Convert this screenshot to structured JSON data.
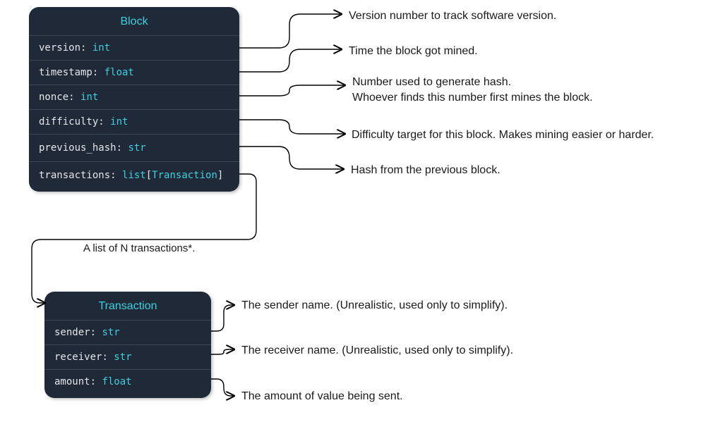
{
  "block": {
    "title": "Block",
    "fields": [
      {
        "name": "version",
        "type": "int"
      },
      {
        "name": "timestamp",
        "type": "float"
      },
      {
        "name": "nonce",
        "type": "int"
      },
      {
        "name": "difficulty",
        "type": "int"
      },
      {
        "name": "previous_hash",
        "type": "str"
      },
      {
        "name": "transactions",
        "type_prefix": "list",
        "type_inner": "Transaction"
      }
    ]
  },
  "transaction": {
    "title": "Transaction",
    "fields": [
      {
        "name": "sender",
        "type": "str"
      },
      {
        "name": "receiver",
        "type": "str"
      },
      {
        "name": "amount",
        "type": "float"
      }
    ]
  },
  "annotations": {
    "version": "Version number to track software version.",
    "timestamp": "Time the block got mined.",
    "nonce_line1": "Number used to generate hash.",
    "nonce_line2": "Whoever finds this number first mines the block.",
    "difficulty": "Difficulty target for this block. Makes mining easier or harder.",
    "previous_hash": "Hash from the previous block.",
    "transactions_note": "A list of N transactions*.",
    "sender": "The sender name. (Unrealistic, used only to simplify).",
    "receiver": "The receiver name. (Unrealistic, used only to simplify).",
    "amount": "The amount of value being sent."
  },
  "colors": {
    "card_bg": "#1f2937",
    "accent": "#3dd0e0"
  }
}
